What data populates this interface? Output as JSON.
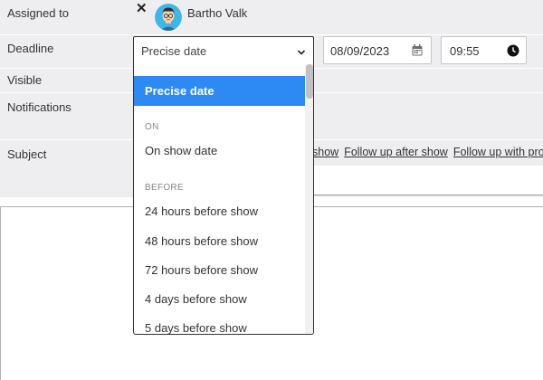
{
  "fields": {
    "assigned_to_label": "Assigned to",
    "deadline_label": "Deadline",
    "visible_label": "Visible",
    "notifications_label": "Notifications",
    "subject_label": "Subject"
  },
  "assignee": {
    "name": "Bartho Valk",
    "remove_icon": "close-icon",
    "avatar_icon": "avatar"
  },
  "deadline": {
    "selected": "Precise date",
    "date": "08/09/2023",
    "time": "09:55",
    "date_icon": "calendar-icon",
    "time_icon": "clock-icon"
  },
  "subject": {
    "quick_links": [
      "show",
      "Follow up after show",
      "Follow up with pro"
    ]
  },
  "dropdown": {
    "selected_option": "Precise date",
    "group_on": "ON",
    "on_options": [
      "On show date"
    ],
    "group_before": "BEFORE",
    "before_options": [
      "24 hours before show",
      "48 hours before show",
      "72 hours before show",
      "4 days before show",
      "5 days before show"
    ]
  },
  "colors": {
    "accent": "#2d8af4",
    "form_background": "#eeeef0"
  }
}
